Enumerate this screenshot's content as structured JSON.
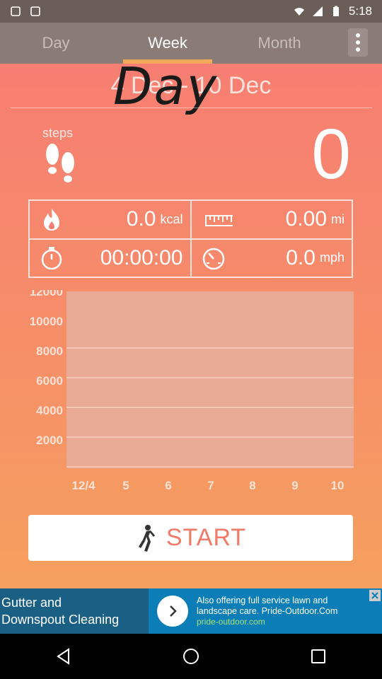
{
  "status_bar": {
    "time": "5:18"
  },
  "tabs": [
    {
      "label": "Day",
      "active": false
    },
    {
      "label": "Week",
      "active": true
    },
    {
      "label": "Month",
      "active": false
    }
  ],
  "header": {
    "date_range": "4 Dec - 10 Dec",
    "overlay_text": "Day"
  },
  "steps": {
    "label": "steps",
    "value": "0"
  },
  "stats": {
    "calories": {
      "value": "0.0",
      "unit": "kcal"
    },
    "distance": {
      "value": "0.00",
      "unit": "mi"
    },
    "duration": {
      "value": "00:00:00"
    },
    "speed": {
      "value": "0.0",
      "unit": "mph"
    }
  },
  "chart_data": {
    "type": "bar",
    "categories": [
      "12/4",
      "5",
      "6",
      "7",
      "8",
      "9",
      "10"
    ],
    "values": [
      0,
      0,
      0,
      0,
      0,
      0,
      0
    ],
    "ylim": [
      0,
      12000
    ],
    "yticks": [
      2000,
      4000,
      6000,
      8000,
      10000,
      12000
    ],
    "grid": true
  },
  "start_button": {
    "label": "START"
  },
  "ad": {
    "title_line1": "Gutter and",
    "title_line2": "Downspout Cleaning",
    "body": "Also offering full service lawn and landscape care. Pride-Outdoor.Com",
    "domain": "pride-outdoor.com"
  },
  "colors": {
    "accent": "#f2a95b",
    "header": "#8a7b76",
    "button_text": "#f17a67",
    "ad_bg": "#0b7eb8"
  }
}
